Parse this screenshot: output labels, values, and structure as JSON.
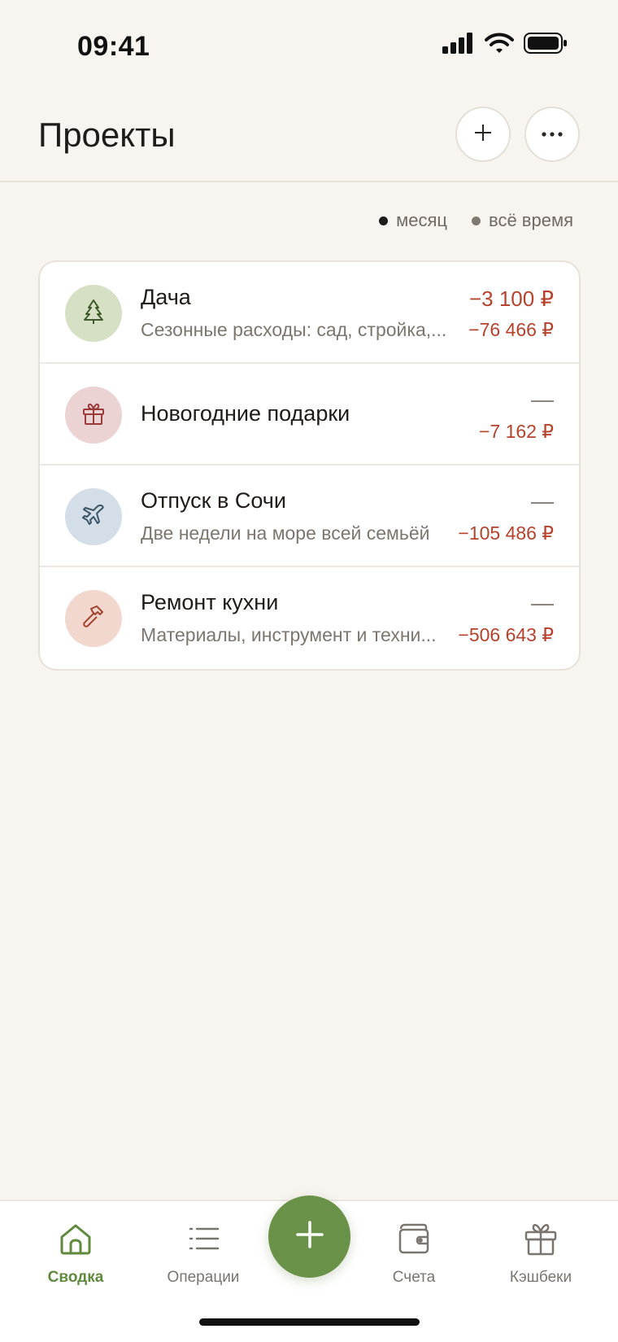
{
  "status_bar": {
    "time": "09:41"
  },
  "header": {
    "title": "Проекты"
  },
  "legend": {
    "month_label": "месяц",
    "all_time_label": "всё время"
  },
  "projects": [
    {
      "name": "Дача",
      "description": "Сезонные расходы: сад, стройка,...",
      "month_amount": "−3 100 ₽",
      "all_time_amount": "−76 466 ₽",
      "icon": "tree-icon",
      "icon_bg": "#D6E0C4",
      "icon_color": "#3F5A2B"
    },
    {
      "name": "Новогодние подарки",
      "description": "",
      "month_amount": "—",
      "all_time_amount": "−7 162 ₽",
      "icon": "gift-icon",
      "icon_bg": "#EBD3D3",
      "icon_color": "#9A3A3A"
    },
    {
      "name": "Отпуск в Сочи",
      "description": "Две недели на море всей семьёй",
      "month_amount": "—",
      "all_time_amount": "−105 486 ₽",
      "icon": "plane-icon",
      "icon_bg": "#D3DEE8",
      "icon_color": "#3E5566"
    },
    {
      "name": "Ремонт кухни",
      "description": "Материалы, инструмент и техни...",
      "month_amount": "—",
      "all_time_amount": "−506 643 ₽",
      "icon": "hammer-icon",
      "icon_bg": "#F2D7CE",
      "icon_color": "#A4432E"
    }
  ],
  "tabbar": {
    "tabs": [
      {
        "label": "Сводка",
        "icon": "home-icon",
        "active": true
      },
      {
        "label": "Операции",
        "icon": "list-icon",
        "active": false
      },
      {
        "label": "Счета",
        "icon": "wallet-icon",
        "active": false
      },
      {
        "label": "Кэшбеки",
        "icon": "gift-icon",
        "active": false
      }
    ]
  },
  "colors": {
    "accent": "#6A9148",
    "negative": "#B5422C",
    "background": "#F8F5F0"
  }
}
